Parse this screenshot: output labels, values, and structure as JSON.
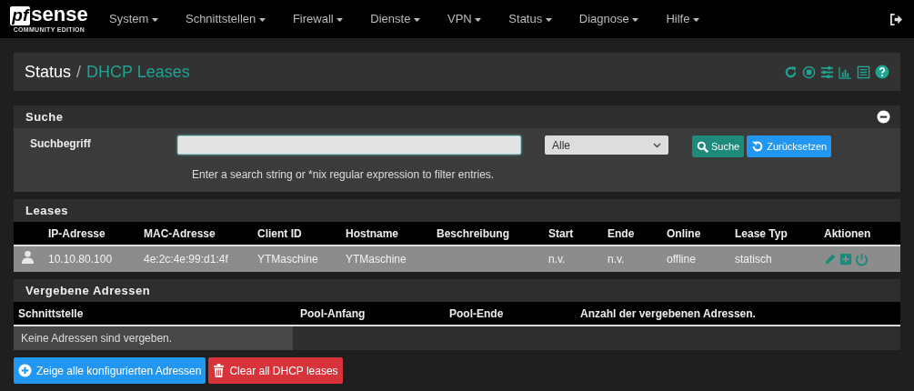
{
  "brand": {
    "logo_mark": "pf",
    "logo_word": "sense",
    "edition": "COMMUNITY EDITION"
  },
  "menu": [
    {
      "label": "System"
    },
    {
      "label": "Schnittstellen"
    },
    {
      "label": "Firewall"
    },
    {
      "label": "Dienste"
    },
    {
      "label": "VPN"
    },
    {
      "label": "Status"
    },
    {
      "label": "Diagnose"
    },
    {
      "label": "Hilfe"
    }
  ],
  "breadcrumb": {
    "parent": "Status",
    "separator": "/",
    "current": "DHCP Leases"
  },
  "search_panel": {
    "title": "Suche",
    "label": "Suchbegriff",
    "filter": {
      "value": "Alle"
    },
    "search_button": "Suche",
    "reset_button": "Zurücksetzen",
    "help": "Enter a search string or *nix regular expression to filter entries."
  },
  "leases": {
    "title": "Leases",
    "columns": [
      "IP-Adresse",
      "MAC-Adresse",
      "Client ID",
      "Hostname",
      "Beschreibung",
      "Start",
      "Ende",
      "Online",
      "Lease Typ",
      "Aktionen"
    ],
    "rows": [
      {
        "ip": "10.10.80.100",
        "mac": "4e:2c:4e:99:d1:4f",
        "client_id": "YTMaschine",
        "hostname": "YTMaschine",
        "start": "n.v.",
        "end": "n.v.",
        "online": "offline",
        "type": "statisch"
      }
    ]
  },
  "pools": {
    "title": "Vergebene Adressen",
    "columns": [
      "Schnittstelle",
      "Pool-Anfang",
      "Pool-Ende",
      "Anzahl der vergebenen Adressen."
    ],
    "empty_message": "Keine Adressen sind vergeben."
  },
  "buttons": [
    {
      "kind": "show",
      "label": "Zeige alle konfigurierten Adressen"
    },
    {
      "kind": "clear",
      "label": "Clear all DHCP leases"
    }
  ]
}
